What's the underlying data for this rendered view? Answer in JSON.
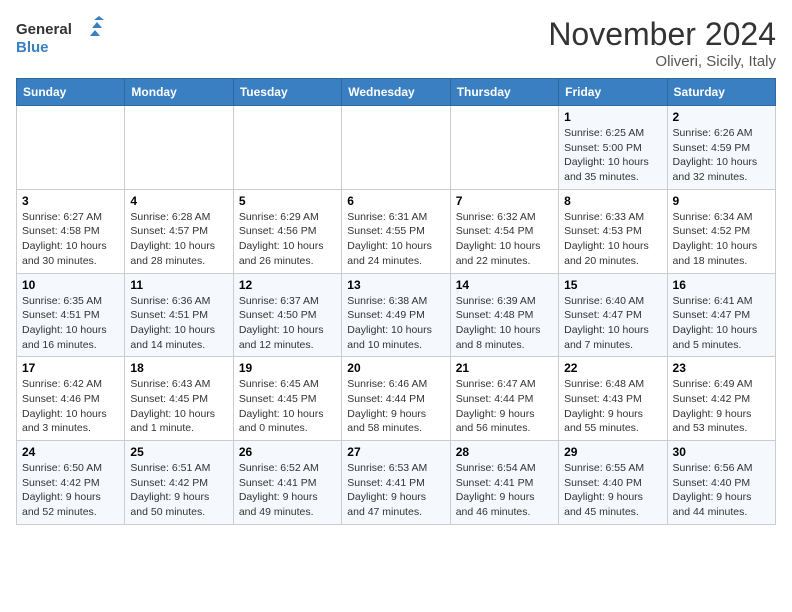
{
  "header": {
    "logo_line1": "General",
    "logo_line2": "Blue",
    "title": "November 2024",
    "location": "Oliveri, Sicily, Italy"
  },
  "weekdays": [
    "Sunday",
    "Monday",
    "Tuesday",
    "Wednesday",
    "Thursday",
    "Friday",
    "Saturday"
  ],
  "weeks": [
    [
      {
        "day": "",
        "info": ""
      },
      {
        "day": "",
        "info": ""
      },
      {
        "day": "",
        "info": ""
      },
      {
        "day": "",
        "info": ""
      },
      {
        "day": "",
        "info": ""
      },
      {
        "day": "1",
        "info": "Sunrise: 6:25 AM\nSunset: 5:00 PM\nDaylight: 10 hours\nand 35 minutes."
      },
      {
        "day": "2",
        "info": "Sunrise: 6:26 AM\nSunset: 4:59 PM\nDaylight: 10 hours\nand 32 minutes."
      }
    ],
    [
      {
        "day": "3",
        "info": "Sunrise: 6:27 AM\nSunset: 4:58 PM\nDaylight: 10 hours\nand 30 minutes."
      },
      {
        "day": "4",
        "info": "Sunrise: 6:28 AM\nSunset: 4:57 PM\nDaylight: 10 hours\nand 28 minutes."
      },
      {
        "day": "5",
        "info": "Sunrise: 6:29 AM\nSunset: 4:56 PM\nDaylight: 10 hours\nand 26 minutes."
      },
      {
        "day": "6",
        "info": "Sunrise: 6:31 AM\nSunset: 4:55 PM\nDaylight: 10 hours\nand 24 minutes."
      },
      {
        "day": "7",
        "info": "Sunrise: 6:32 AM\nSunset: 4:54 PM\nDaylight: 10 hours\nand 22 minutes."
      },
      {
        "day": "8",
        "info": "Sunrise: 6:33 AM\nSunset: 4:53 PM\nDaylight: 10 hours\nand 20 minutes."
      },
      {
        "day": "9",
        "info": "Sunrise: 6:34 AM\nSunset: 4:52 PM\nDaylight: 10 hours\nand 18 minutes."
      }
    ],
    [
      {
        "day": "10",
        "info": "Sunrise: 6:35 AM\nSunset: 4:51 PM\nDaylight: 10 hours\nand 16 minutes."
      },
      {
        "day": "11",
        "info": "Sunrise: 6:36 AM\nSunset: 4:51 PM\nDaylight: 10 hours\nand 14 minutes."
      },
      {
        "day": "12",
        "info": "Sunrise: 6:37 AM\nSunset: 4:50 PM\nDaylight: 10 hours\nand 12 minutes."
      },
      {
        "day": "13",
        "info": "Sunrise: 6:38 AM\nSunset: 4:49 PM\nDaylight: 10 hours\nand 10 minutes."
      },
      {
        "day": "14",
        "info": "Sunrise: 6:39 AM\nSunset: 4:48 PM\nDaylight: 10 hours\nand 8 minutes."
      },
      {
        "day": "15",
        "info": "Sunrise: 6:40 AM\nSunset: 4:47 PM\nDaylight: 10 hours\nand 7 minutes."
      },
      {
        "day": "16",
        "info": "Sunrise: 6:41 AM\nSunset: 4:47 PM\nDaylight: 10 hours\nand 5 minutes."
      }
    ],
    [
      {
        "day": "17",
        "info": "Sunrise: 6:42 AM\nSunset: 4:46 PM\nDaylight: 10 hours\nand 3 minutes."
      },
      {
        "day": "18",
        "info": "Sunrise: 6:43 AM\nSunset: 4:45 PM\nDaylight: 10 hours\nand 1 minute."
      },
      {
        "day": "19",
        "info": "Sunrise: 6:45 AM\nSunset: 4:45 PM\nDaylight: 10 hours\nand 0 minutes."
      },
      {
        "day": "20",
        "info": "Sunrise: 6:46 AM\nSunset: 4:44 PM\nDaylight: 9 hours\nand 58 minutes."
      },
      {
        "day": "21",
        "info": "Sunrise: 6:47 AM\nSunset: 4:44 PM\nDaylight: 9 hours\nand 56 minutes."
      },
      {
        "day": "22",
        "info": "Sunrise: 6:48 AM\nSunset: 4:43 PM\nDaylight: 9 hours\nand 55 minutes."
      },
      {
        "day": "23",
        "info": "Sunrise: 6:49 AM\nSunset: 4:42 PM\nDaylight: 9 hours\nand 53 minutes."
      }
    ],
    [
      {
        "day": "24",
        "info": "Sunrise: 6:50 AM\nSunset: 4:42 PM\nDaylight: 9 hours\nand 52 minutes."
      },
      {
        "day": "25",
        "info": "Sunrise: 6:51 AM\nSunset: 4:42 PM\nDaylight: 9 hours\nand 50 minutes."
      },
      {
        "day": "26",
        "info": "Sunrise: 6:52 AM\nSunset: 4:41 PM\nDaylight: 9 hours\nand 49 minutes."
      },
      {
        "day": "27",
        "info": "Sunrise: 6:53 AM\nSunset: 4:41 PM\nDaylight: 9 hours\nand 47 minutes."
      },
      {
        "day": "28",
        "info": "Sunrise: 6:54 AM\nSunset: 4:41 PM\nDaylight: 9 hours\nand 46 minutes."
      },
      {
        "day": "29",
        "info": "Sunrise: 6:55 AM\nSunset: 4:40 PM\nDaylight: 9 hours\nand 45 minutes."
      },
      {
        "day": "30",
        "info": "Sunrise: 6:56 AM\nSunset: 4:40 PM\nDaylight: 9 hours\nand 44 minutes."
      }
    ]
  ]
}
